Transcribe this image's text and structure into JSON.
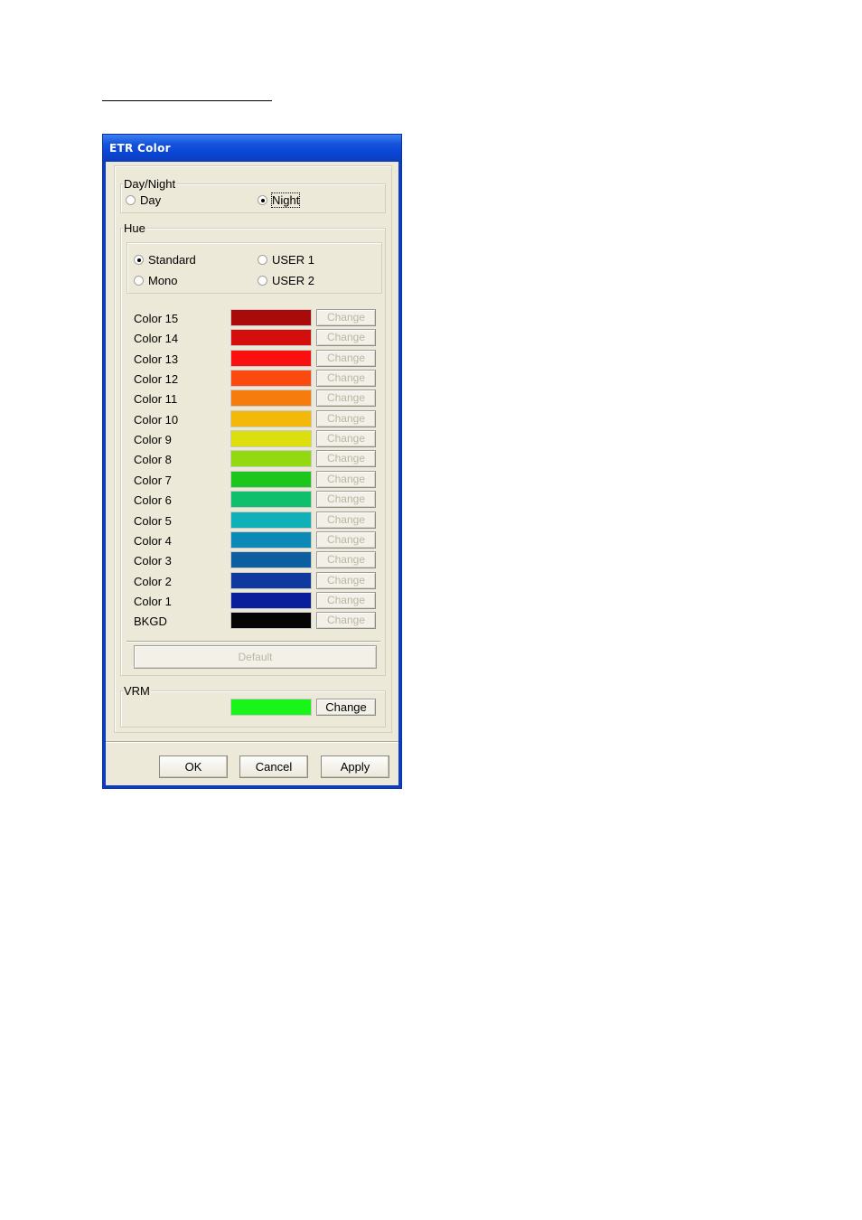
{
  "window": {
    "title": "ETR Color"
  },
  "day_night": {
    "label": "Day/Night",
    "day_label": "Day",
    "night_label": "Night",
    "selected": "Night"
  },
  "hue": {
    "label": "Hue",
    "standard_label": "Standard",
    "user1_label": "USER 1",
    "mono_label": "Mono",
    "user2_label": "USER 2",
    "selected": "Standard",
    "colors": [
      {
        "label": "Color 15",
        "color": "#a90a0a",
        "button": "Change"
      },
      {
        "label": "Color 14",
        "color": "#d40d0d",
        "button": "Change"
      },
      {
        "label": "Color 13",
        "color": "#fb1010",
        "button": "Change"
      },
      {
        "label": "Color 12",
        "color": "#fa4a10",
        "button": "Change"
      },
      {
        "label": "Color 11",
        "color": "#f77c0e",
        "button": "Change"
      },
      {
        "label": "Color 10",
        "color": "#f2b90b",
        "button": "Change"
      },
      {
        "label": "Color 9",
        "color": "#dddf0d",
        "button": "Change"
      },
      {
        "label": "Color 8",
        "color": "#92d911",
        "button": "Change"
      },
      {
        "label": "Color 7",
        "color": "#1dc61d",
        "button": "Change"
      },
      {
        "label": "Color 6",
        "color": "#0fbf6c",
        "button": "Change"
      },
      {
        "label": "Color 5",
        "color": "#10b0b8",
        "button": "Change"
      },
      {
        "label": "Color 4",
        "color": "#0b8ab8",
        "button": "Change"
      },
      {
        "label": "Color 3",
        "color": "#0c5ea0",
        "button": "Change"
      },
      {
        "label": "Color 2",
        "color": "#0e3aa0",
        "button": "Change"
      },
      {
        "label": "Color 1",
        "color": "#0a1e9c",
        "button": "Change"
      },
      {
        "label": "BKGD",
        "color": "#050505",
        "button": "Change"
      }
    ],
    "default_button": "Default"
  },
  "vrm": {
    "label": "VRM",
    "color": "#19f519",
    "button": "Change"
  },
  "footer": {
    "ok": "OK",
    "cancel": "Cancel",
    "apply": "Apply"
  }
}
